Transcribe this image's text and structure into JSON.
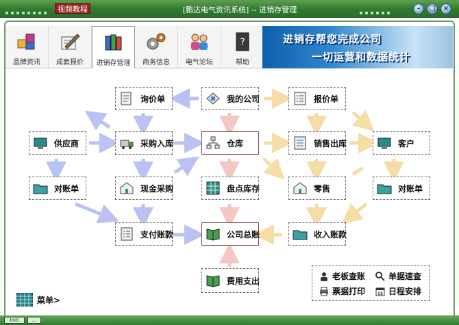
{
  "window": {
    "tag": "视频教程",
    "title": "[鹏达电气资讯系统] -- 进销存管理",
    "buttons": [
      "-",
      "□",
      "×"
    ]
  },
  "toolbar": [
    {
      "label": "品牌资讯",
      "icon": "blocks-icon"
    },
    {
      "label": "成套报价",
      "icon": "pen-paper-icon"
    },
    {
      "label": "进销存管理",
      "icon": "books-icon",
      "active": true
    },
    {
      "label": "商务信息",
      "icon": "gears-icon"
    },
    {
      "label": "电气论坛",
      "icon": "people-icon"
    },
    {
      "label": "帮助",
      "icon": "help-book-icon"
    }
  ],
  "banner": {
    "line1": "进销存帮您完成公司",
    "line2": "一切运营和数据统计"
  },
  "flow": {
    "inquiry": "询价单",
    "my_company": "我的公司",
    "quotation": "报价单",
    "supplier": "供应商",
    "purchase_in": "采购入库",
    "warehouse": "仓库",
    "sales_out": "销售出库",
    "customer": "客户",
    "statement_left": "对账单",
    "cash_purchase": "现金采购",
    "stocktake": "盘点库存",
    "retail": "零售",
    "statement_right": "对账单",
    "payment": "支付账款",
    "general_ledger": "公司总账",
    "receipt": "收入账款",
    "expense": "费用支出"
  },
  "shortcuts": {
    "boss_view": "老板查账",
    "doc_search": "单据速查",
    "print_docs": "票据打印",
    "schedule": "日程安排"
  },
  "menu": {
    "label": "菜单>"
  },
  "status": {
    "left": "Initi",
    "mid": "..."
  },
  "colors": {
    "title_green": "#2f7a2e",
    "arrow_blue": "#b9c2f2",
    "arrow_orange": "#f6dca5",
    "arrow_pink": "#f3c8c2",
    "banner_blue": "#1f72c0"
  }
}
